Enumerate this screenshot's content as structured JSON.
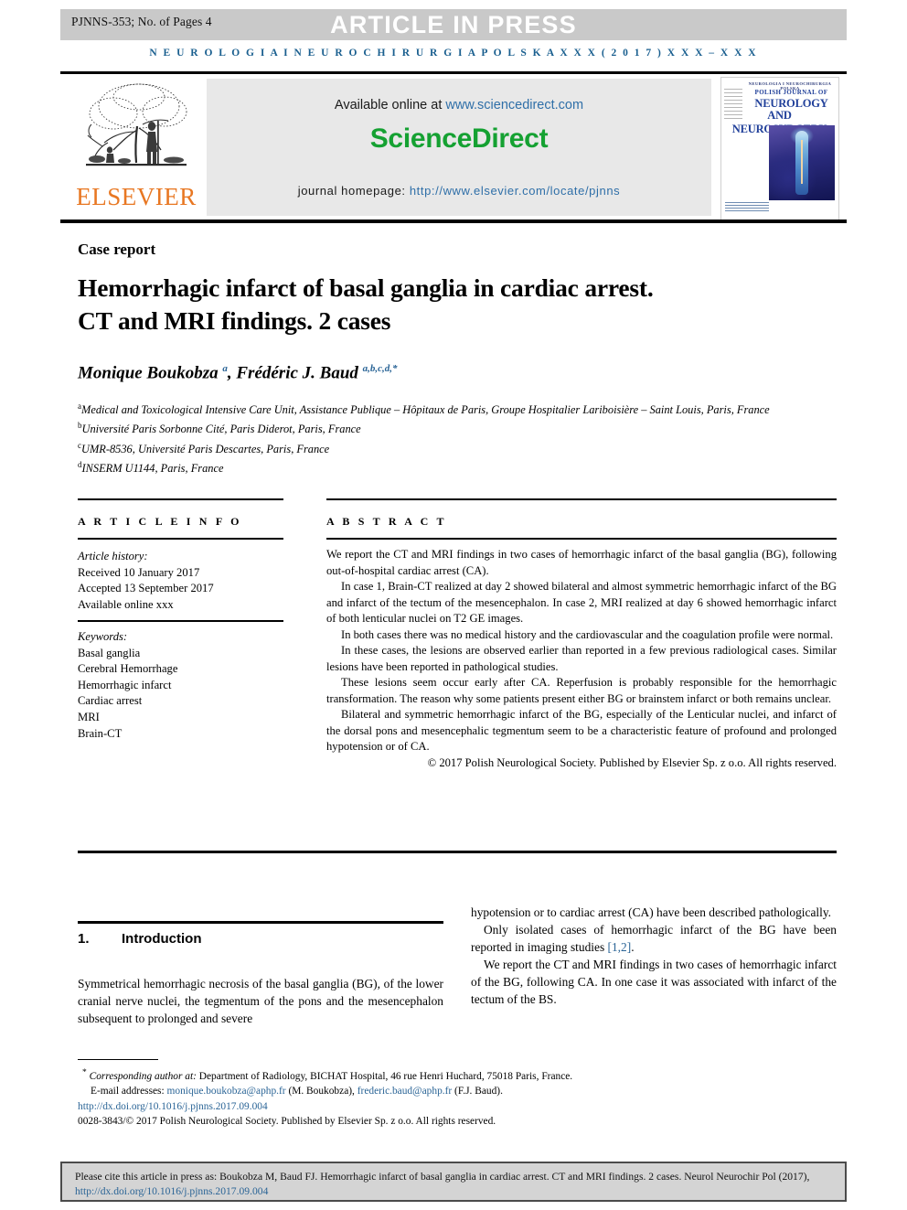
{
  "banner": {
    "left_text": "PJNNS-353; No. of Pages 4",
    "title": "ARTICLE IN PRESS"
  },
  "running_head": "N E U R O L O G I A   I   N E U R O C H I R U R G I A   P O L S K A   X X X   ( 2 0 1 7 )   X X X – X X X",
  "masthead": {
    "publisher": "ELSEVIER",
    "available_prefix": "Available online at ",
    "available_url": "www.sciencedirect.com",
    "sciencedirect": "ScienceDirect",
    "homepage_label": "journal homepage: ",
    "homepage_url": "http://www.elsevier.com/locate/pjnns",
    "cover": {
      "top_strip": "NEUROLOGIA I NEUROCHIRURGIA POLSKA",
      "line1": "POLISH JOURNAL OF",
      "line2": "NEUROLOGY",
      "line3": "AND NEUROSURGERY"
    }
  },
  "article": {
    "section_label": "Case report",
    "title": "Hemorrhagic infarct of basal ganglia in cardiac arrest. CT and MRI findings. 2 cases",
    "authors_html": "Monique Boukobza <sup>a</sup>, Frédéric J. Baud <sup>a,b,c,d,*</sup>",
    "affiliations": [
      "Medical and Toxicological Intensive Care Unit, Assistance Publique – Hôpitaux de Paris, Groupe Hospitalier Lariboisière – Saint Louis, Paris, France",
      "Université Paris Sorbonne Cité, Paris Diderot, Paris, France",
      "UMR-8536, Université Paris Descartes, Paris, France",
      "INSERM U1144, Paris, France"
    ],
    "affiliation_marks": [
      "a",
      "b",
      "c",
      "d"
    ]
  },
  "info": {
    "heading": "A R T I C L E   I N F O",
    "history_label": "Article history:",
    "history": [
      "Received 10 January 2017",
      "Accepted 13 September 2017",
      "Available online xxx"
    ],
    "keywords_label": "Keywords:",
    "keywords": [
      "Basal ganglia",
      "Cerebral Hemorrhage",
      "Hemorrhagic infarct",
      "Cardiac arrest",
      "MRI",
      "Brain-CT"
    ]
  },
  "abstract": {
    "heading": "A B S T R A C T",
    "paragraphs": [
      "We report the CT and MRI findings in two cases of hemorrhagic infarct of the basal ganglia (BG), following out-of-hospital cardiac arrest (CA).",
      "In case 1, Brain-CT realized at day 2 showed bilateral and almost symmetric hemorrhagic infarct of the BG and infarct of the tectum of the mesencephalon. In case 2, MRI realized at day 6 showed hemorrhagic infarct of both lenticular nuclei on T2 GE images.",
      "In both cases there was no medical history and the cardiovascular and the coagulation profile were normal.",
      "In these cases, the lesions are observed earlier than reported in a few previous radiological cases. Similar lesions have been reported in pathological studies.",
      "These lesions seem occur early after CA. Reperfusion is probably responsible for the hemorrhagic transformation. The reason why some patients present either BG or brainstem infarct or both remains unclear.",
      "Bilateral and symmetric hemorrhagic infarct of the BG, especially of the Lenticular nuclei, and infarct of the dorsal pons and mesencephalic tegmentum seem to be a characteristic feature of profound and prolonged hypotension or of CA."
    ],
    "copyright": "© 2017 Polish Neurological Society. Published by Elsevier Sp. z o.o. All rights reserved."
  },
  "body": {
    "section_number": "1.",
    "section_title": "Introduction",
    "left_paragraph": "Symmetrical hemorrhagic necrosis of the basal ganglia (BG), of the lower cranial nerve nuclei, the tegmentum of the pons and the mesencephalon subsequent to prolonged and severe",
    "right_paragraphs": [
      "hypotension or to cardiac arrest (CA) have been described pathologically.",
      "Only isolated cases of hemorrhagic infarct of the BG have been reported in imaging studies ",
      "We report the CT and MRI findings in two cases of hemorrhagic infarct of the BG, following CA. In one case it was associated with infarct of the tectum of the BS."
    ],
    "reference_link": "[1,2]",
    "reference_tail": "."
  },
  "footnotes": {
    "corresponding_marker": "*",
    "corresponding_label": "Corresponding author at:",
    "corresponding_text": " Department of Radiology, BICHAT Hospital, 46 rue Henri Huchard, 75018 Paris, France.",
    "email_label": "E-mail addresses:",
    "email1": "monique.boukobza@aphp.fr",
    "email1_name": " (M. Boukobza), ",
    "email2": "frederic.baud@aphp.fr",
    "email2_name": " (F.J. Baud).",
    "doi": "http://dx.doi.org/10.1016/j.pjnns.2017.09.004",
    "issn_line": "0028-3843/© 2017 Polish Neurological Society. Published by Elsevier Sp. z o.o. All rights reserved."
  },
  "citation_box": {
    "text": "Please cite this article in press as: Boukobza  M, Baud  FJ. Hemorrhagic infarct of basal ganglia in cardiac arrest. CT and MRI findings. 2 cases. Neurol Neurochir Pol (2017), ",
    "link": "http://dx.doi.org/10.1016/j.pjnns.2017.09.004"
  },
  "colors": {
    "banner_bg": "#c9c9c9",
    "journal_blue": "#1a5f8f",
    "sciencedirect_green": "#15a132",
    "elsevier_orange": "#e87722",
    "link_blue": "#2a6496",
    "sd_panel": "#e8e8e8",
    "cite_box_bg": "#d4d4d4"
  }
}
